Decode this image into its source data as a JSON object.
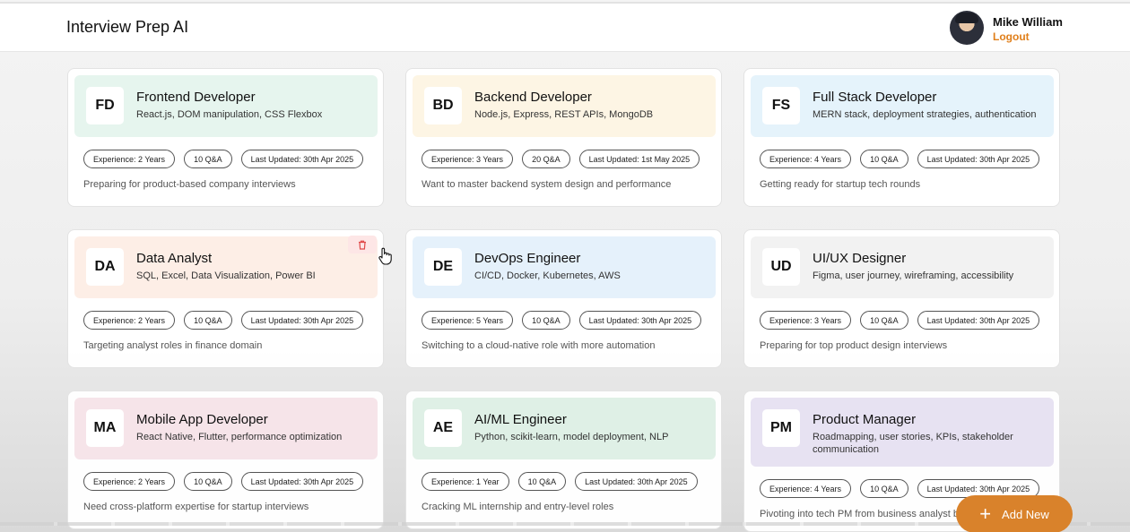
{
  "app": {
    "title": "Interview Prep AI"
  },
  "user": {
    "name": "Mike William",
    "logout_label": "Logout"
  },
  "cards": [
    {
      "initials": "FD",
      "role": "Frontend Developer",
      "topics": "React.js, DOM manipulation, CSS Flexbox",
      "experience": "Experience: 2 Years",
      "qa": "10 Q&A",
      "updated": "Last Updated: 30th Apr 2025",
      "description": "Preparing for product-based company interviews",
      "color": "#e6f5ee"
    },
    {
      "initials": "BD",
      "role": "Backend Developer",
      "topics": "Node.js, Express, REST APIs, MongoDB",
      "experience": "Experience: 3 Years",
      "qa": "20 Q&A",
      "updated": "Last Updated: 1st May 2025",
      "description": "Want to master backend system design and performance",
      "color": "#fdf5e4"
    },
    {
      "initials": "FS",
      "role": "Full Stack Developer",
      "topics": "MERN stack, deployment strategies, authentication",
      "experience": "Experience: 4 Years",
      "qa": "10 Q&A",
      "updated": "Last Updated: 30th Apr 2025",
      "description": "Getting ready for startup tech rounds",
      "color": "#e5f3fb"
    },
    {
      "initials": "DA",
      "role": "Data Analyst",
      "topics": "SQL, Excel, Data Visualization, Power BI",
      "experience": "Experience: 2 Years",
      "qa": "10 Q&A",
      "updated": "Last Updated: 30th Apr 2025",
      "description": "Targeting analyst roles in finance domain",
      "color": "#fdeee6"
    },
    {
      "initials": "DE",
      "role": "DevOps Engineer",
      "topics": "CI/CD, Docker, Kubernetes, AWS",
      "experience": "Experience: 5 Years",
      "qa": "10 Q&A",
      "updated": "Last Updated: 30th Apr 2025",
      "description": "Switching to a cloud-native role with more automation",
      "color": "#e5f1fb"
    },
    {
      "initials": "UD",
      "role": "UI/UX Designer",
      "topics": "Figma, user journey, wireframing, accessibility",
      "experience": "Experience: 3 Years",
      "qa": "10 Q&A",
      "updated": "Last Updated: 30th Apr 2025",
      "description": "Preparing for top product design interviews",
      "color": "#f2f2f2"
    },
    {
      "initials": "MA",
      "role": "Mobile App Developer",
      "topics": "React Native, Flutter, performance optimization",
      "experience": "Experience: 2 Years",
      "qa": "10 Q&A",
      "updated": "Last Updated: 30th Apr 2025",
      "description": "Need cross-platform expertise for startup interviews",
      "color": "#f6e4e9"
    },
    {
      "initials": "AE",
      "role": "AI/ML Engineer",
      "topics": "Python, scikit-learn, model deployment, NLP",
      "experience": "Experience: 1 Year",
      "qa": "10 Q&A",
      "updated": "Last Updated: 30th Apr 2025",
      "description": "Cracking ML internship and entry-level roles",
      "color": "#dff0e6"
    },
    {
      "initials": "PM",
      "role": "Product Manager",
      "topics": "Roadmapping, user stories, KPIs, stakeholder communication",
      "experience": "Experience: 4 Years",
      "qa": "10 Q&A",
      "updated": "Last Updated: 30th Apr 2025",
      "description": "Pivoting into tech PM from business analyst back",
      "color": "#e7e2f2"
    }
  ],
  "fab": {
    "label": "Add New",
    "plus": "+"
  },
  "colors": {
    "accent": "#d9822b",
    "logout": "#e07f1a",
    "delete": "#e04848"
  }
}
